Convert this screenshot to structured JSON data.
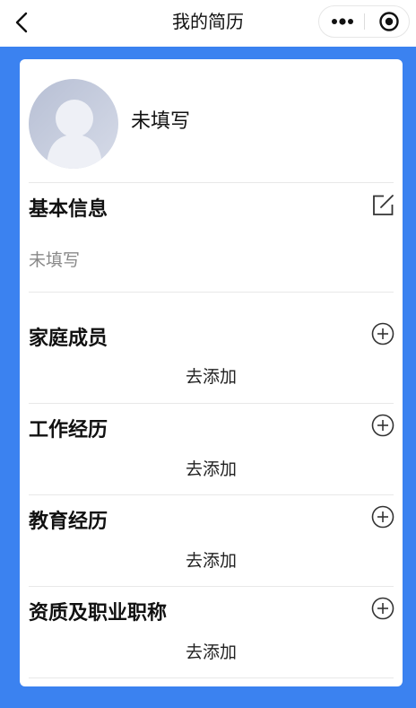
{
  "nav": {
    "title": "我的简历",
    "icons": {
      "back": "back-chevron-icon",
      "more": "more-dots-icon",
      "target": "target-circle-icon"
    }
  },
  "profile": {
    "name": "未填写",
    "avatar_icon": "default-avatar-icon"
  },
  "sections": {
    "basic_info": {
      "title": "基本信息",
      "value": "未填写",
      "icon": "edit-icon"
    },
    "family": {
      "title": "家庭成员",
      "action": "去添加",
      "icon": "add-circle-icon"
    },
    "work": {
      "title": "工作经历",
      "action": "去添加",
      "icon": "add-circle-icon"
    },
    "education": {
      "title": "教育经历",
      "action": "去添加",
      "icon": "add-circle-icon"
    },
    "qualification": {
      "title": "资质及职业职称",
      "action": "去添加",
      "icon": "add-circle-icon"
    }
  },
  "colors": {
    "background": "#3b82f0",
    "card": "#ffffff",
    "text": "#111111",
    "muted": "#888888"
  }
}
